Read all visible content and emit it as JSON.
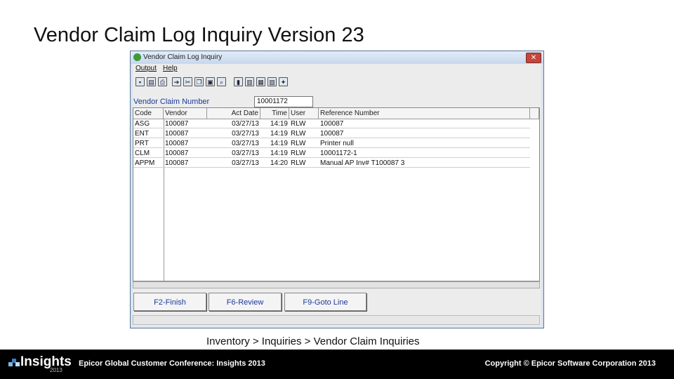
{
  "slide": {
    "title": "Vendor Claim Log Inquiry Version 23",
    "caption": "Inventory > Inquiries > Vendor Claim Inquiries"
  },
  "window": {
    "title": "Vendor Claim Log Inquiry",
    "close_glyph": "✕"
  },
  "menu": {
    "output": "Output",
    "help": "Help"
  },
  "toolbar": {
    "icons": [
      "save-icon",
      "print-preview-icon",
      "print-icon",
      "run-icon",
      "cut-icon",
      "copy-icon",
      "paste-icon",
      "find-icon",
      "exit-icon",
      "books-icon",
      "calculator-icon",
      "calendar-icon",
      "wizard-icon"
    ]
  },
  "claim": {
    "label": "Vendor Claim Number",
    "value": "10001172"
  },
  "grid": {
    "columns": [
      "Code",
      "Vendor",
      "Act Date",
      "Time",
      "User",
      "Reference Number"
    ],
    "rows": [
      {
        "code": "ASG",
        "vendor": "100087",
        "date": "03/27/13",
        "time": "14:19",
        "user": "RLW",
        "ref": "100087"
      },
      {
        "code": "ENT",
        "vendor": "100087",
        "date": "03/27/13",
        "time": "14:19",
        "user": "RLW",
        "ref": "100087"
      },
      {
        "code": "PRT",
        "vendor": "100087",
        "date": "03/27/13",
        "time": "14:19",
        "user": "RLW",
        "ref": " Printer null"
      },
      {
        "code": "CLM",
        "vendor": "100087",
        "date": "03/27/13",
        "time": "14:19",
        "user": "RLW",
        "ref": "10001172-1"
      },
      {
        "code": "APPM",
        "vendor": "100087",
        "date": "03/27/13",
        "time": "14:20",
        "user": "RLW",
        "ref": "Manual AP Inv# T100087 3"
      }
    ]
  },
  "buttons": {
    "finish": "F2-Finish",
    "review": "F6-Review",
    "goto": "F9-Goto Line"
  },
  "footer": {
    "logo": "Insights",
    "logo_year": "2013",
    "left": "Epicor Global Customer Conference: Insights 2013",
    "right": "Copyright © Epicor Software Corporation 2013"
  }
}
